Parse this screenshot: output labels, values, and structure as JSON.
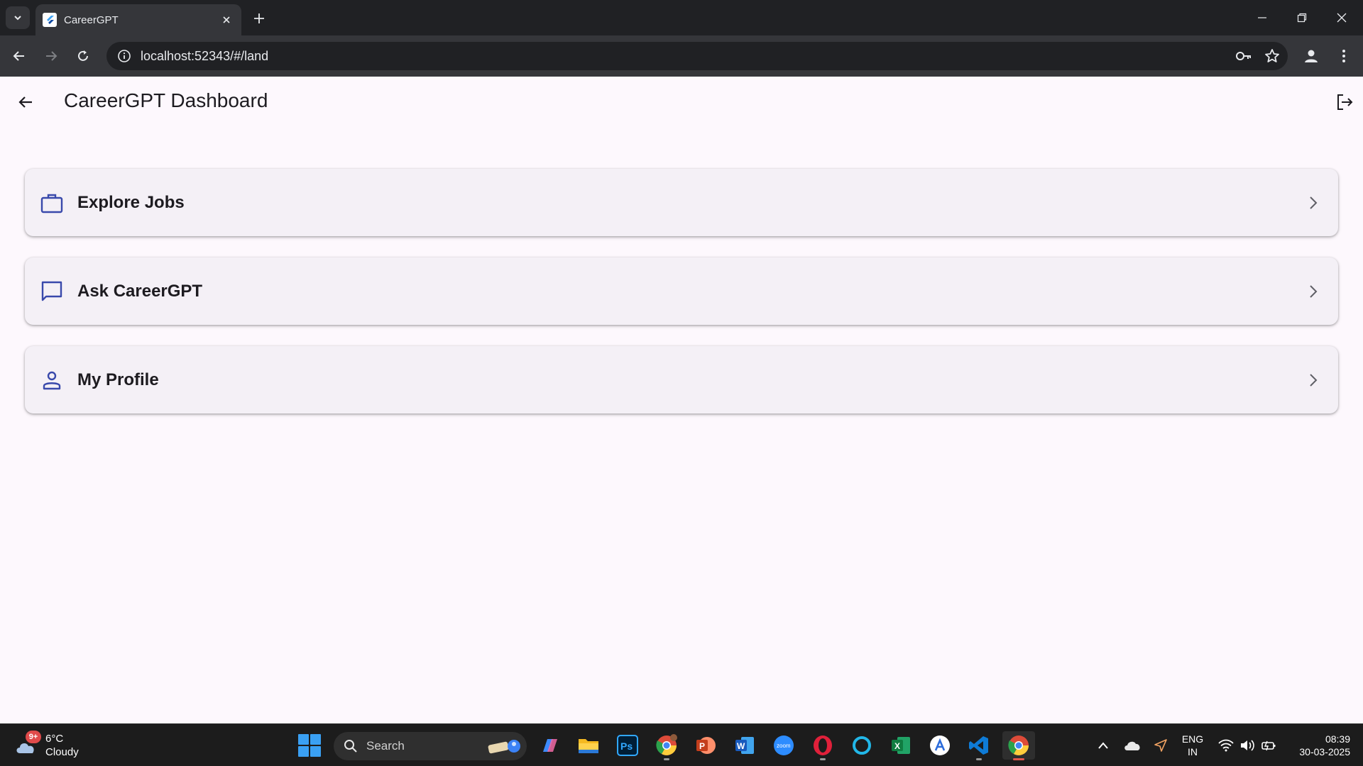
{
  "browser": {
    "tab_title": "CareerGPT",
    "url": "localhost:52343/#/land"
  },
  "app": {
    "title": "CareerGPT Dashboard",
    "accent_color": "#3949ab"
  },
  "cards": [
    {
      "label": "Explore Jobs",
      "icon": "briefcase-icon"
    },
    {
      "label": "Ask CareerGPT",
      "icon": "chat-bubble-icon"
    },
    {
      "label": "My Profile",
      "icon": "person-icon"
    }
  ],
  "taskbar": {
    "weather_badge": "9+",
    "temperature": "6°C",
    "condition": "Cloudy",
    "search_label": "Search",
    "lang_primary": "ENG",
    "lang_region": "IN",
    "time": "08:39",
    "date": "30-03-2025",
    "apps": [
      "copilot-icon",
      "file-explorer-icon",
      "photoshop-icon",
      "chrome-profile-icon",
      "powerpoint-icon",
      "word-icon",
      "zoom-icon",
      "opera-icon",
      "cortana-icon",
      "excel-icon",
      "app-store-icon",
      "vscode-icon",
      "chrome-icon"
    ]
  }
}
